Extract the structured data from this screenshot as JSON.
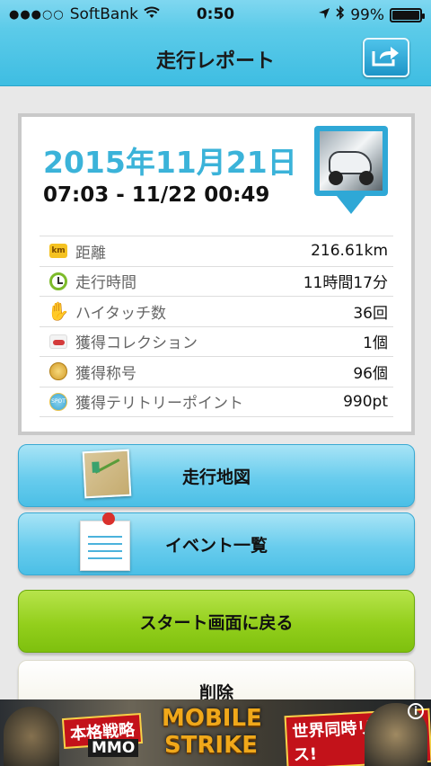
{
  "status_bar": {
    "carrier": "SoftBank",
    "time": "0:50",
    "battery": "99%",
    "battery_level": 0.99
  },
  "nav": {
    "title": "走行レポート"
  },
  "report": {
    "date": "2015年11月21日",
    "time_range": "07:03 - 11/22 00:49",
    "stats": [
      {
        "icon": "km-icon",
        "icon_text": "km",
        "label": "距離",
        "value": "216.61km"
      },
      {
        "icon": "clock-icon",
        "label": "走行時間",
        "value": "11時間17分"
      },
      {
        "icon": "hand-icon",
        "label": "ハイタッチ数",
        "value": "36回"
      },
      {
        "icon": "car-icon",
        "label": "獲得コレクション",
        "value": "1個"
      },
      {
        "icon": "medal-icon",
        "label": "獲得称号",
        "value": "96個"
      },
      {
        "icon": "spot-icon",
        "icon_text": "SPOT",
        "label": "獲得テリトリーポイント",
        "value": "990pt"
      }
    ]
  },
  "buttons": {
    "map": "走行地図",
    "events": "イベント一覧",
    "back_to_start": "スタート画面に戻る",
    "delete": "削除"
  },
  "ad": {
    "text_left": "本格戦略",
    "text_left2": "MMO",
    "logo_line1": "MOBILE",
    "logo_line2": "STRIKE",
    "text_right": "世界同時リリース!",
    "info": "i"
  }
}
